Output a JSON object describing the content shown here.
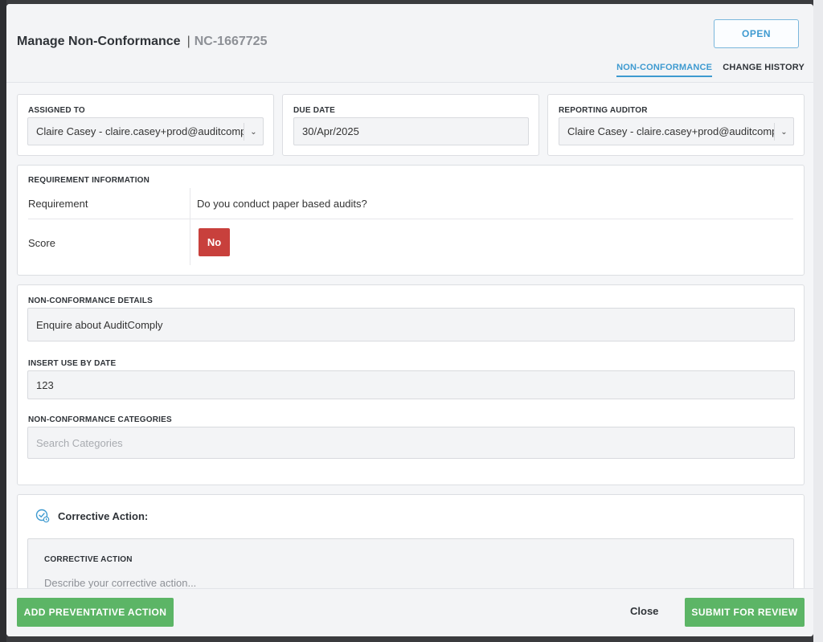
{
  "header": {
    "title": "Manage Non-Conformance",
    "separator": "|",
    "nc_id": "NC-1667725",
    "status_button": "OPEN",
    "tabs": [
      {
        "label": "NON-CONFORMANCE",
        "active": true
      },
      {
        "label": "CHANGE HISTORY",
        "active": false
      }
    ]
  },
  "assigned_to": {
    "label": "ASSIGNED TO",
    "value": "Claire Casey - claire.casey+prod@auditcomply.com"
  },
  "due_date": {
    "label": "DUE DATE",
    "value": "30/Apr/2025"
  },
  "reporting_auditor": {
    "label": "REPORTING AUDITOR",
    "value": "Claire Casey - claire.casey+prod@auditcomply.com"
  },
  "requirement_info": {
    "label": "REQUIREMENT INFORMATION",
    "requirement_label": "Requirement",
    "requirement_value": "Do you conduct paper based audits?",
    "score_label": "Score",
    "score_value": "No"
  },
  "details": {
    "nc_details_label": "NON-CONFORMANCE DETAILS",
    "nc_details_value": "Enquire about AuditComply",
    "use_by_label": "INSERT USE BY DATE",
    "use_by_value": "123",
    "categories_label": "NON-CONFORMANCE CATEGORIES",
    "categories_placeholder": "Search Categories"
  },
  "corrective_action": {
    "title": "Corrective Action:",
    "field_label": "CORRECTIVE ACTION",
    "placeholder": "Describe your corrective action..."
  },
  "footer": {
    "add_preventative": "ADD PREVENTATIVE ACTION",
    "close": "Close",
    "submit": "SUBMIT FOR REVIEW"
  },
  "colors": {
    "accent": "#3e9ad0",
    "success": "#5cb566",
    "danger": "#c8403c"
  }
}
